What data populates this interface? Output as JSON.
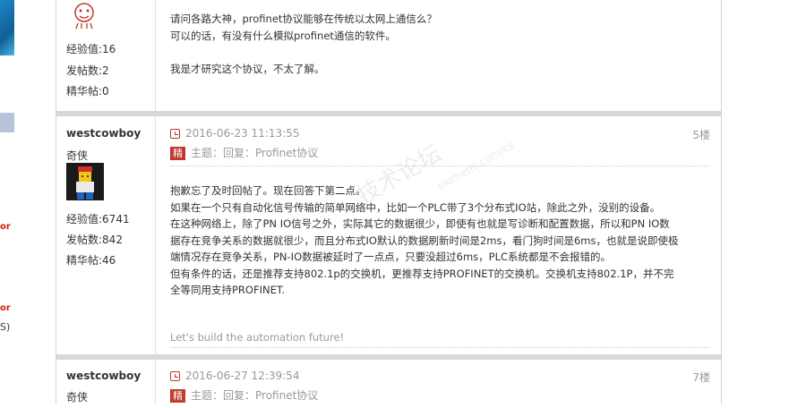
{
  "left_fragments": {
    "red_a": "or",
    "red_b": "or",
    "paren": "S)"
  },
  "post1": {
    "stats": {
      "exp": "经验值:16",
      "posts": "发帖数:2",
      "elite": "精华帖:0"
    },
    "body": [
      "请问各路大神，profinet协议能够在传统以太网上通信么？",
      "可以的话，有没有什么模拟profinet通信的软件。",
      "",
      "我是才研究这个协议，不太了解。"
    ]
  },
  "post2": {
    "username": "westcowboy",
    "rank": "奇侠",
    "stats": {
      "exp": "经验值:6741",
      "posts": "发帖数:842",
      "elite": "精华帖:46"
    },
    "datetime": "2016-06-23 11:13:55",
    "floor": "5楼",
    "badge": "精",
    "subject": "主题：回复：Profinet协议",
    "body": [
      "抱歉忘了及时回帖了。现在回答下第二点。",
      "如果在一个只有自动化信号传输的简单网络中，比如一个PLC带了3个分布式IO站，除此之外，没别的设备。",
      "在这种网络上，除了PN IO信号之外，实际其它的数据很少，即使有也就是写诊断和配置数据，所以和PN IO数",
      "据存在竞争关系的数据就很少，而且分布式IO默认的数据刷新时间是2ms，看门狗时间是6ms，也就是说即使极",
      "端情况存在竞争关系，PN-IO数据被延时了一点点，只要没超过6ms，PLC系统都是不会报错的。",
      "但有条件的话，还是推荐支持802.1p的交换机，更推荐支持PROFINET的交换机。交换机支持802.1P，并不完",
      "全等同用支持PROFINET."
    ],
    "signature": "Let's build the automation future!"
  },
  "post3": {
    "username": "westcowboy",
    "rank": "奇侠",
    "datetime": "2016-06-27 12:39:54",
    "floor": "7楼",
    "badge": "精",
    "subject": "主题：回复：Profinet协议"
  },
  "watermark": {
    "main": "技术论坛",
    "sub": "siemens.com/cs"
  },
  "colors": {
    "accent_red": "#c0392b",
    "separator": "#d8d8d8"
  }
}
